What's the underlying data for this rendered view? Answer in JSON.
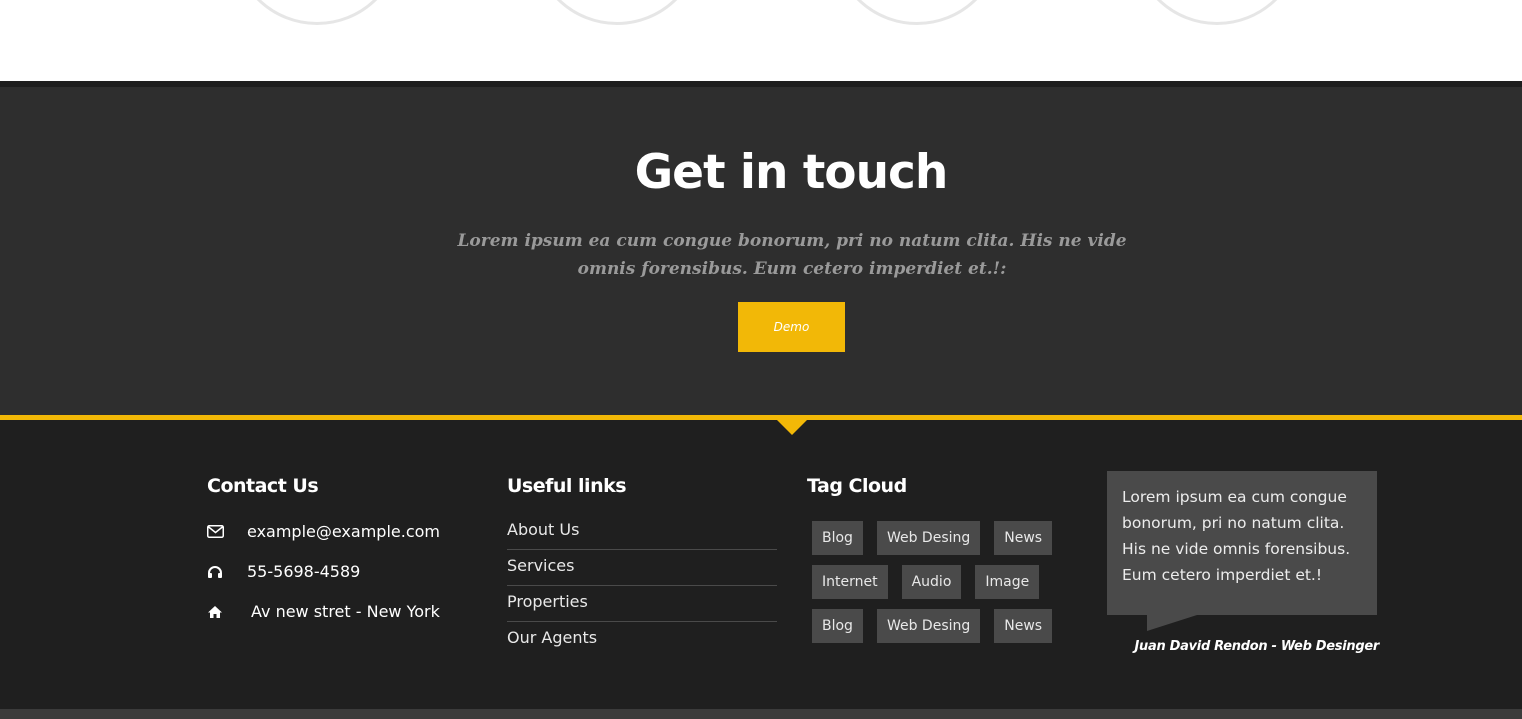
{
  "hero": {
    "title": "Get in touch",
    "subtitle": "Lorem ipsum ea cum congue bonorum, pri no natum clita. His ne vide omnis forensibus. Eum cetero imperdiet et.!:",
    "button_label": "Demo"
  },
  "footer": {
    "contact": {
      "title": "Contact Us",
      "email": "example@example.com",
      "phone": "55-5698-4589",
      "address": "Av new stret - New York"
    },
    "links": {
      "title": "Useful links",
      "items": [
        "About Us",
        "Services",
        "Properties",
        "Our Agents"
      ]
    },
    "tags": {
      "title": "Tag Cloud",
      "rows": [
        [
          "Blog",
          "Web Desing",
          "News"
        ],
        [
          "Internet",
          "Audio",
          "Image"
        ],
        [
          "Blog",
          "Web Desing",
          "News"
        ]
      ]
    },
    "testimonial": {
      "text": "Lorem ipsum ea cum congue bonorum, pri no natum clita. His ne vide omnis forensibus. Eum cetero imperdiet et.!",
      "author": "Juan David Rendon - Web Desinger"
    }
  },
  "colors": {
    "accent": "#f2b807",
    "section_bg": "#2e2e2e",
    "footer_bg": "#1f1f1f",
    "tag_bg": "#4a4a4a"
  },
  "icons": {
    "email": "envelope-icon",
    "phone": "headphones-icon",
    "address": "home-icon"
  }
}
